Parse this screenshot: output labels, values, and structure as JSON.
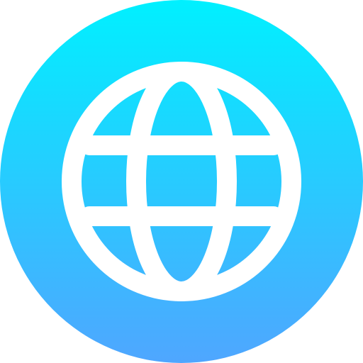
{
  "icon": {
    "name": "globe-icon",
    "colors": {
      "gradient_top": "#00F0FF",
      "gradient_bottom": "#4FA6FF",
      "foreground": "#FFFFFF"
    }
  }
}
